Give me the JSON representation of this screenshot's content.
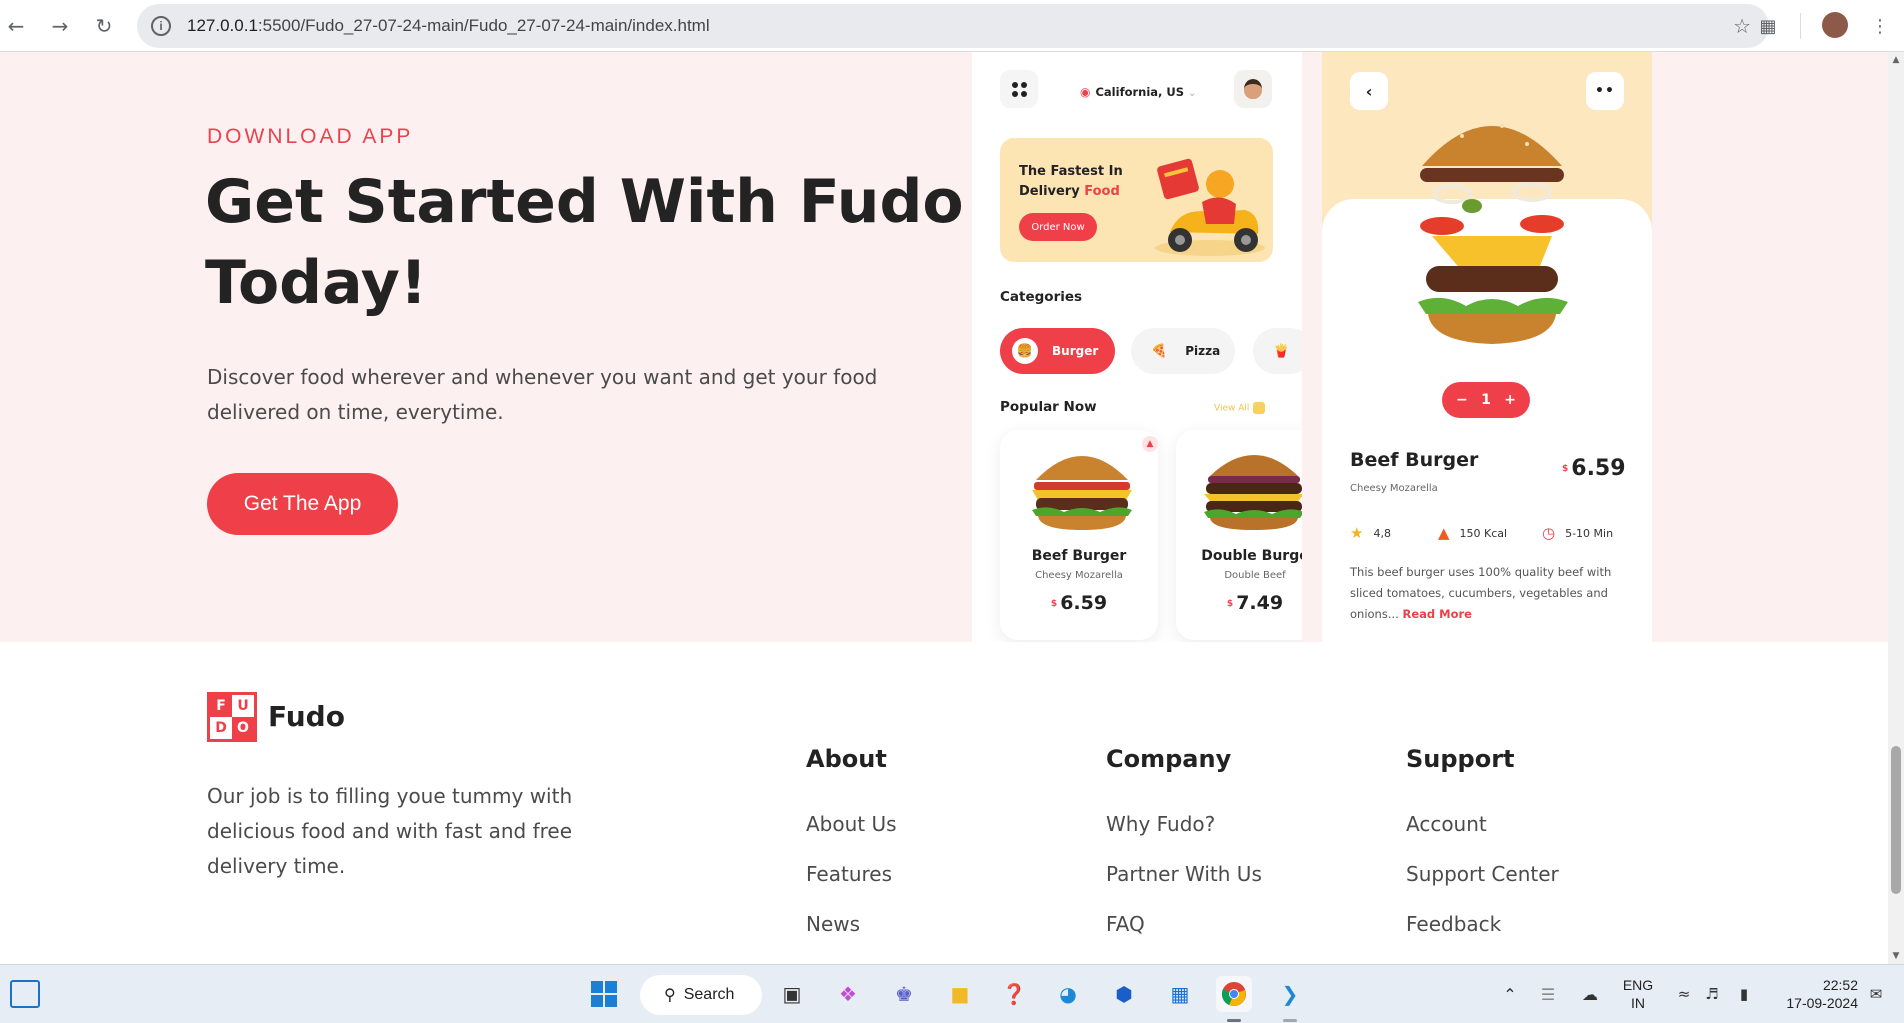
{
  "browser": {
    "url_host": "127.0.0.1",
    "url_path": ":5500/Fudo_27-07-24-main/Fudo_27-07-24-main/index.html"
  },
  "hero": {
    "eyebrow": "DOWNLOAD APP",
    "title": "Get Started With Fudo Today!",
    "description": "Discover food wherever and whenever you want and get your food delivered on time, everytime.",
    "cta_label": "Get The App"
  },
  "app_home": {
    "location": "California, US",
    "promo_line1": "The Fastest In",
    "promo_line2_prefix": "Delivery ",
    "promo_line2_accent": "Food",
    "promo_button": "Order Now",
    "categories_title": "Categories",
    "categories": [
      {
        "label": "Burger",
        "icon": "burger-icon"
      },
      {
        "label": "Pizza",
        "icon": "pizza-icon"
      },
      {
        "label": "",
        "icon": "fries-icon"
      }
    ],
    "popular_title": "Popular Now",
    "view_all": "View All",
    "items": [
      {
        "name": "Beef Burger",
        "sub": "Cheesy Mozarella",
        "currency": "$",
        "price": "6.59"
      },
      {
        "name": "Double Burge",
        "sub": "Double Beef",
        "currency": "$",
        "price": "7.49"
      }
    ]
  },
  "app_detail": {
    "quantity": "1",
    "minus": "−",
    "plus": "+",
    "name": "Beef Burger",
    "currency": "$",
    "price": "6.59",
    "sub": "Cheesy Mozarella",
    "rating": "4,8",
    "calories": "150 Kcal",
    "time": "5-10 Min",
    "description": "This beef burger uses 100% quality beef with sliced tomatoes, cucumbers, vegetables and onions...",
    "read_more": "Read More"
  },
  "footer": {
    "logo_letters": [
      "F",
      "U",
      "D",
      "O"
    ],
    "brand": "Fudo",
    "description": "Our job is to filling youe tummy with delicious food and with fast and free delivery time.",
    "columns": [
      {
        "title": "About",
        "links": [
          "About Us",
          "Features",
          "News"
        ]
      },
      {
        "title": "Company",
        "links": [
          "Why Fudo?",
          "Partner With Us",
          "FAQ"
        ]
      },
      {
        "title": "Support",
        "links": [
          "Account",
          "Support Center",
          "Feedback"
        ]
      }
    ]
  },
  "taskbar": {
    "search": "Search",
    "lang_line1": "ENG",
    "lang_line2": "IN",
    "time": "22:52",
    "date": "17-09-2024"
  },
  "colors": {
    "accent": "#ef4049",
    "hero_bg": "#fdf0f1",
    "promo_bg": "#fde5b3"
  }
}
